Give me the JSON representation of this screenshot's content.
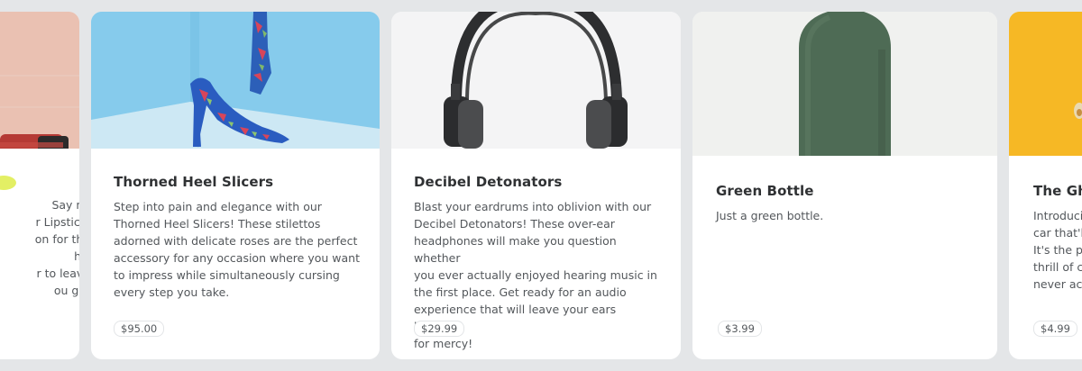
{
  "cards": [
    {
      "title": "",
      "description": "Say no\nr Lipstick,\non for the\nhis\nr to leave\nou go!",
      "price": ""
    },
    {
      "title": "Thorned Heel Slicers",
      "description": "Step into pain and elegance with our\nThorned Heel Slicers! These stilettos\nadorned with delicate roses are the perfect\naccessory for any occasion where you want\nto impress while simultaneously cursing\nevery step you take.",
      "price": "$95.00"
    },
    {
      "title": "Decibel Detonators",
      "description": "Blast your eardrums into oblivion with our\nDecibel Detonators! These over-ear\nheadphones will make you question whether\nyou ever actually enjoyed hearing music in\nthe first place. Get ready for an audio\nexperience that will leave your ears begging\nfor mercy!",
      "price": "$29.99"
    },
    {
      "title": "Green Bottle",
      "description": "Just a green bottle.",
      "price": "$3.99"
    },
    {
      "title": "The Gh",
      "description": "Introduci\ncar that'l\nIt's the p\nthrill of c\nnever ac",
      "price": "$4.99"
    }
  ],
  "colors": {
    "page_background": "#e4e6e8",
    "card_background": "#ffffff",
    "bottle_green": "#4e6b55",
    "card5_yellow": "#f7bd2b"
  },
  "icons": [
    "lipstick-image",
    "heels-image",
    "headphones-image",
    "bottle-image",
    "yellow-product-image"
  ]
}
